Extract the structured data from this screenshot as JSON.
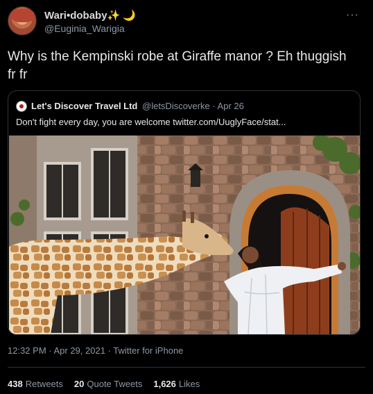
{
  "author": {
    "display_name": "Wari•dobaby",
    "sparkle": "✨",
    "moon": "🌙",
    "handle": "@Euginia_Warigia"
  },
  "menu": {
    "more_label": "···"
  },
  "tweet_text": "Why is the Kempinski robe at Giraffe manor ? Eh thuggish fr fr",
  "quote": {
    "display_name": "Let's Discover Travel Ltd",
    "handle_date": "@letsDiscoverke · Apr 26",
    "text": "Don't fight every day, you are welcome  twitter.com/UuglyFace/stat..."
  },
  "timestamp": "12:32 PM · Apr 29, 2021 · Twitter for iPhone",
  "stats": {
    "retweets_count": "438",
    "retweets_label": "Retweets",
    "quotes_count": "20",
    "quotes_label": "Quote Tweets",
    "likes_count": "1,626",
    "likes_label": "Likes"
  }
}
